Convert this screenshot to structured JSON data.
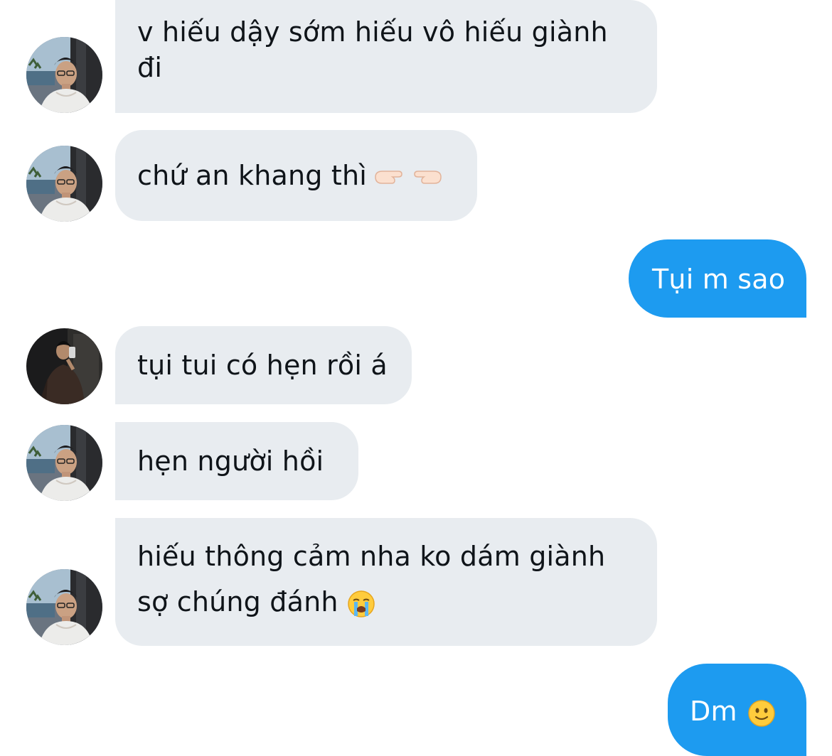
{
  "conversation": {
    "messages": [
      {
        "direction": "incoming",
        "avatar": "avatar-boy-glasses",
        "line1": "v hiếu dậy sớm hiếu vô hiếu giành",
        "line2": "đi"
      },
      {
        "direction": "incoming",
        "avatar": "avatar-boy-glasses",
        "text": "chứ an khang thì",
        "emoji": "pointing-fingers-icon"
      },
      {
        "direction": "outgoing",
        "text": "Tụi m sao"
      },
      {
        "direction": "incoming",
        "avatar": "avatar-mirror-selfie",
        "text": "tụi tui có hẹn rồi á"
      },
      {
        "direction": "incoming",
        "avatar": "avatar-boy-glasses",
        "text": "hẹn người hồi"
      },
      {
        "direction": "incoming",
        "avatar": "avatar-boy-glasses",
        "line1": "hiếu thông cảm nha ko dám giành",
        "line2": "sợ chúng đánh",
        "emoji": "crying-face-icon"
      },
      {
        "direction": "outgoing",
        "text": "Dm",
        "emoji": "slightly-smiling-face-icon"
      }
    ]
  },
  "colors": {
    "incoming_bubble": "#e8ecf0",
    "outgoing_bubble": "#1d9bf0",
    "incoming_text": "#0f1419",
    "outgoing_text": "#ffffff"
  }
}
